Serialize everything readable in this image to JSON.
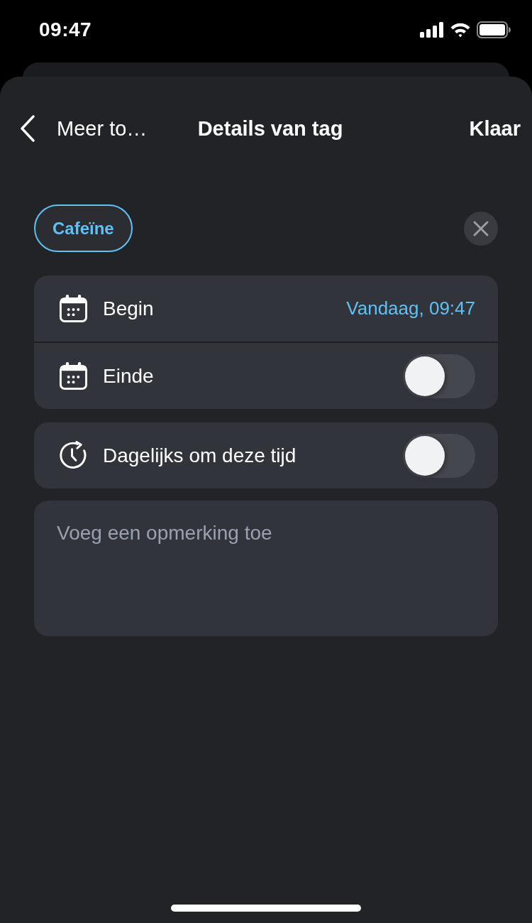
{
  "status_bar": {
    "time": "09:47"
  },
  "nav": {
    "back_label": "Meer to…",
    "title": "Details van tag",
    "done": "Klaar"
  },
  "tag": {
    "label": "Cafeïne"
  },
  "schedule": [
    {
      "kind": "value",
      "label": "Begin",
      "value": "Vandaag, 09:47"
    },
    {
      "kind": "toggle",
      "label": "Einde",
      "on": false
    }
  ],
  "repeat": {
    "label": "Dagelijks om deze tijd",
    "on": false
  },
  "note": {
    "placeholder": "Voeg een opmerking toe"
  }
}
